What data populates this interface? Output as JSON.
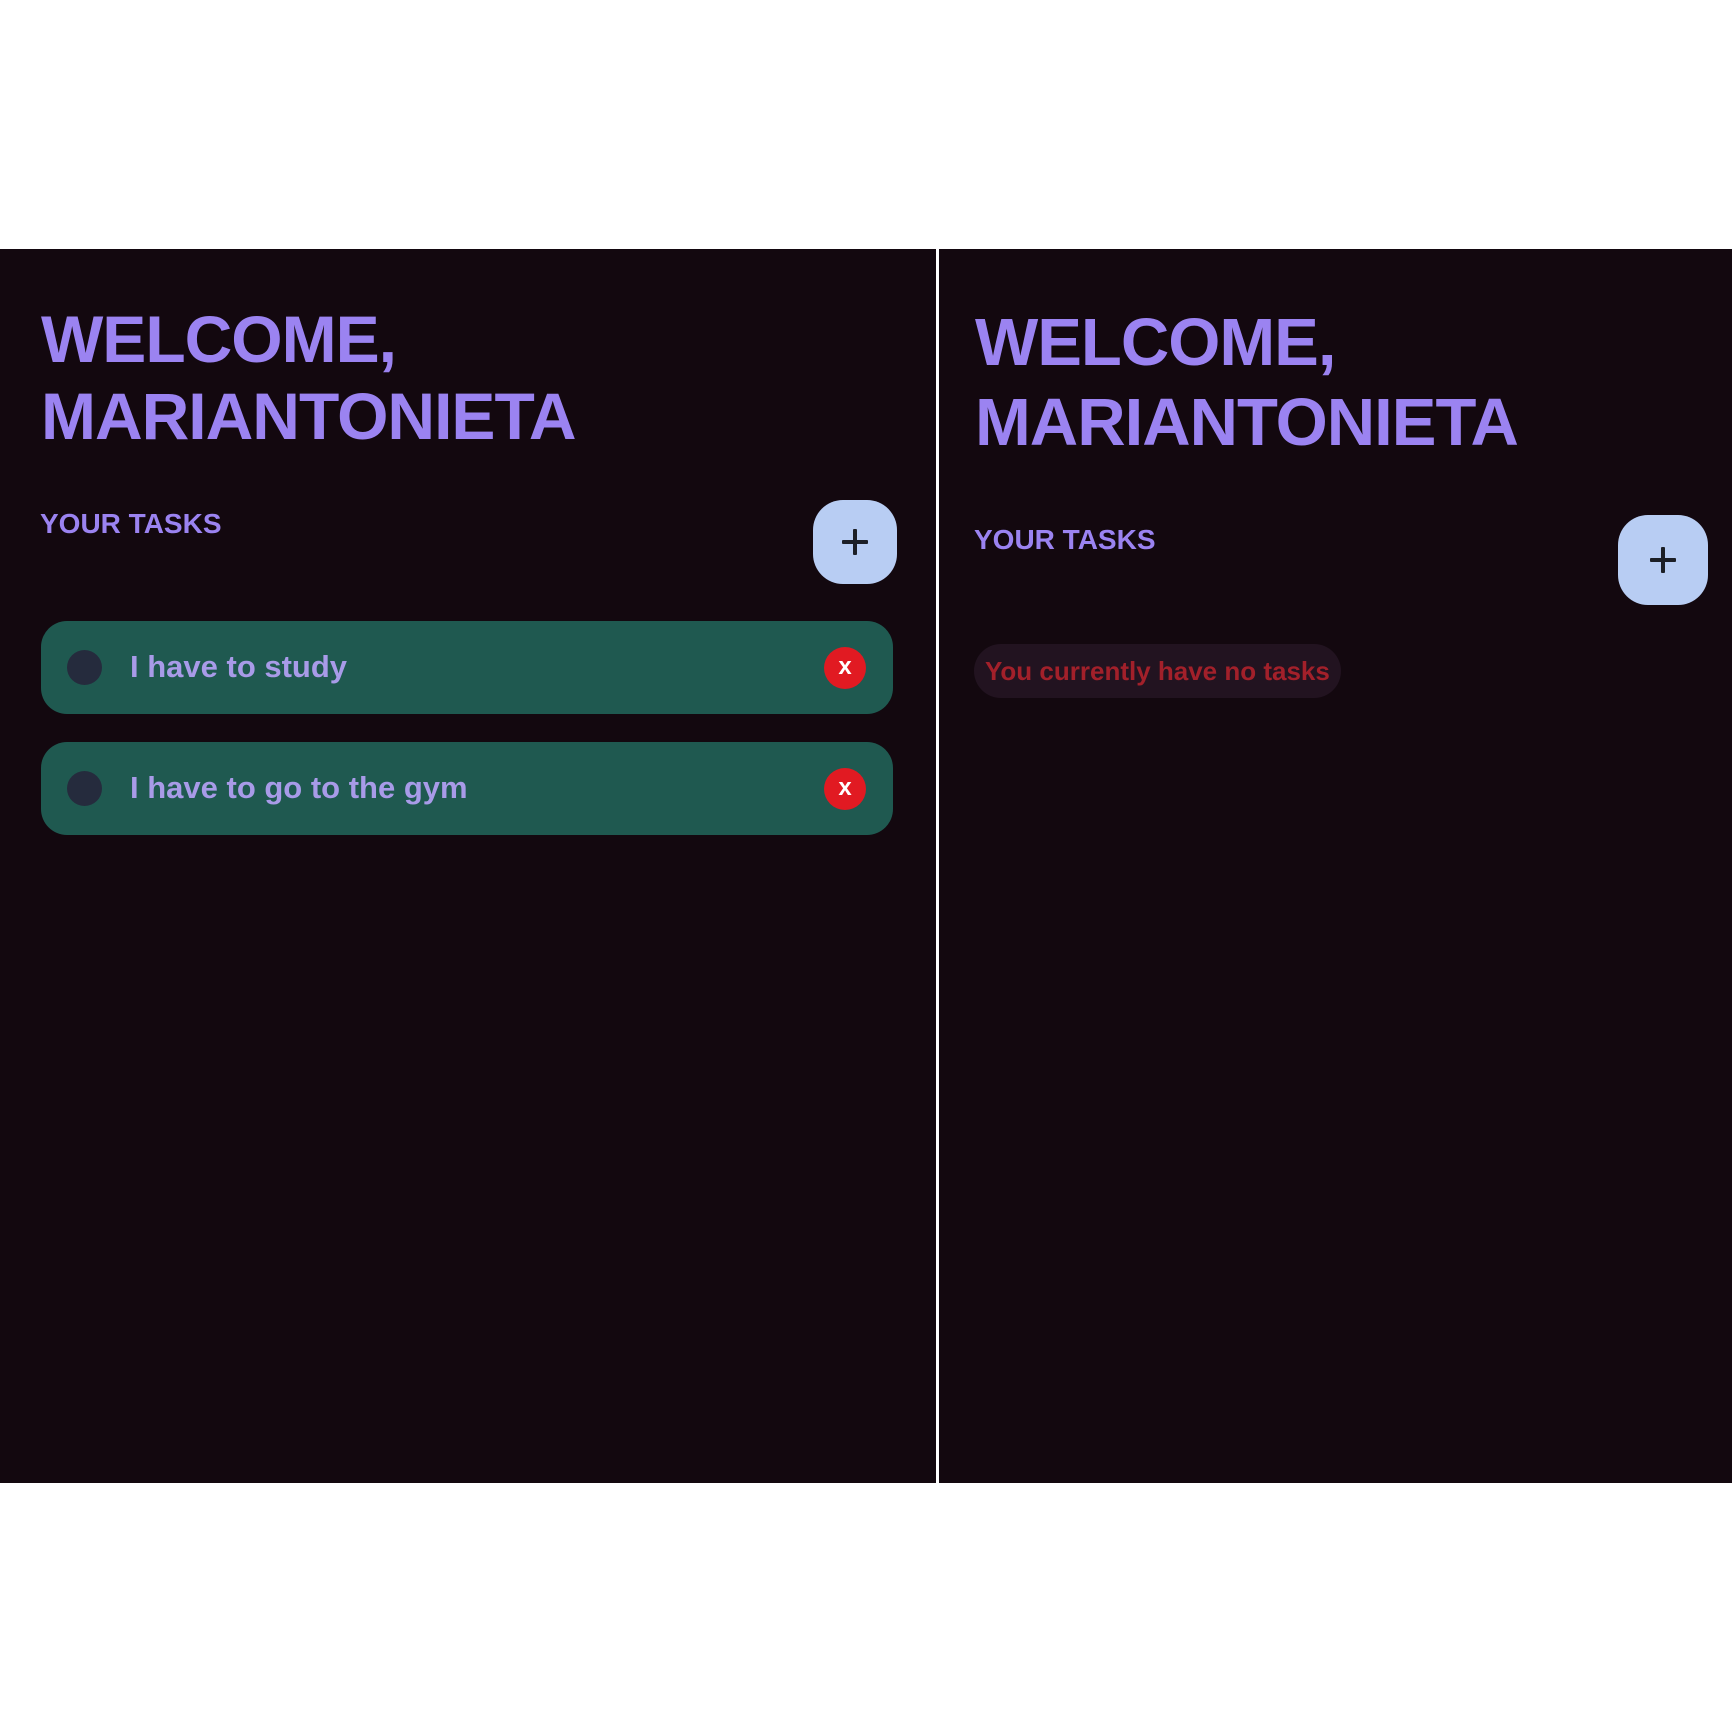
{
  "colors": {
    "page_background": "#13080f",
    "divider": "#ffffff",
    "heading": "#9b83f1",
    "add_button": "#b8cdf3",
    "task_card": "#1f5950",
    "task_text": "#a89be8",
    "task_checkbox": "#252b3d",
    "delete_button": "#e11a22",
    "empty_state_text": "#a2202a"
  },
  "screens": [
    {
      "welcome_line_1": "WELCOME,",
      "welcome_line_2": "MARIANTONIETA",
      "section_label": "YOUR TASKS",
      "add_icon": "plus-icon",
      "tasks": [
        {
          "text": "I have to study",
          "delete_label": "x"
        },
        {
          "text": "I have to go to the gym",
          "delete_label": "x"
        }
      ]
    },
    {
      "welcome_line_1": "WELCOME,",
      "welcome_line_2": "MARIANTONIETA",
      "section_label": "YOUR TASKS",
      "add_icon": "plus-icon",
      "empty_message": "You currently have no tasks"
    }
  ]
}
